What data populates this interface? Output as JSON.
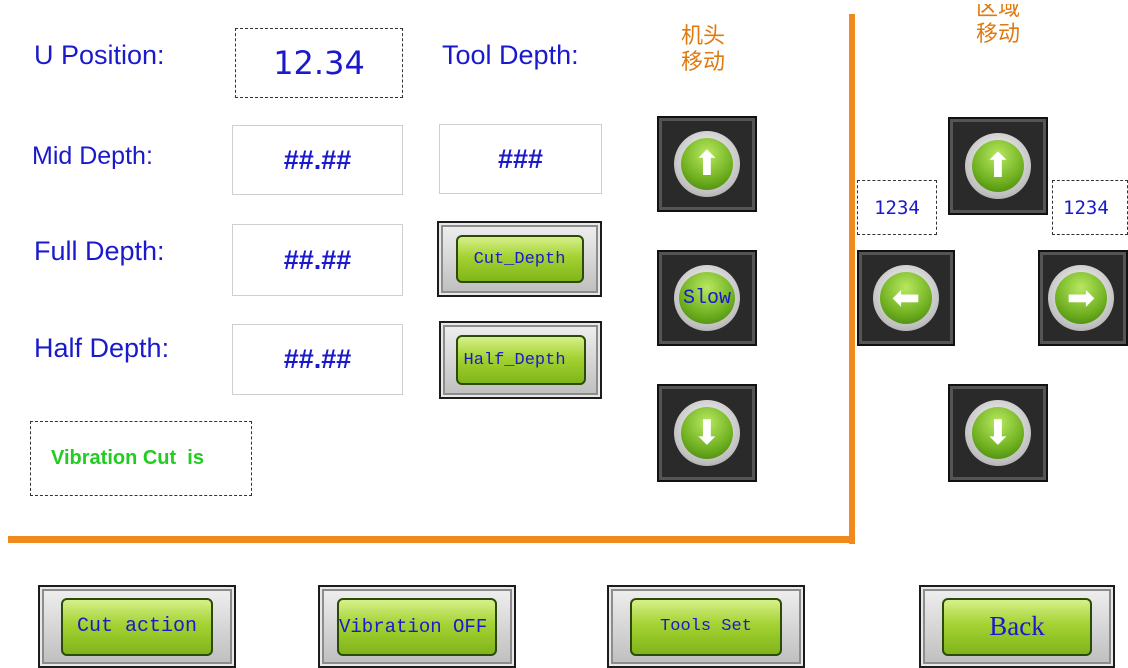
{
  "labels": {
    "u_position": "U Position:",
    "tool_depth": "Tool Depth:",
    "mid_depth": "Mid Depth:",
    "full_depth": "Full Depth:",
    "half_depth": "Half Depth:"
  },
  "values": {
    "u_position": "12.34",
    "mid_depth": "##.##",
    "tool_depth": "###",
    "full_depth": "##.##",
    "half_depth": "##.##"
  },
  "status": {
    "vibration": "Vibration Cut  is"
  },
  "head_move": {
    "title_line1": "机头",
    "title_line2": "移动",
    "slow_label": "Slow"
  },
  "area_move": {
    "title_line1": "区域",
    "title_line2": "移动",
    "left_value": "1234",
    "right_value": "1234"
  },
  "buttons": {
    "cut_depth": "Cut_Depth",
    "half_depth": "Half_Depth",
    "cut_action": "Cut action",
    "vibration_off": "Vibration OFF",
    "tools_set": "Tools Set",
    "back": "Back"
  },
  "icons": [
    "arrow-up-icon",
    "arrow-down-icon",
    "arrow-left-icon",
    "arrow-right-icon"
  ],
  "colors": {
    "accent_orange": "#f08a1e",
    "label_blue": "#1a1acc",
    "status_green": "#22cc22",
    "button_green": "#a4d232"
  }
}
